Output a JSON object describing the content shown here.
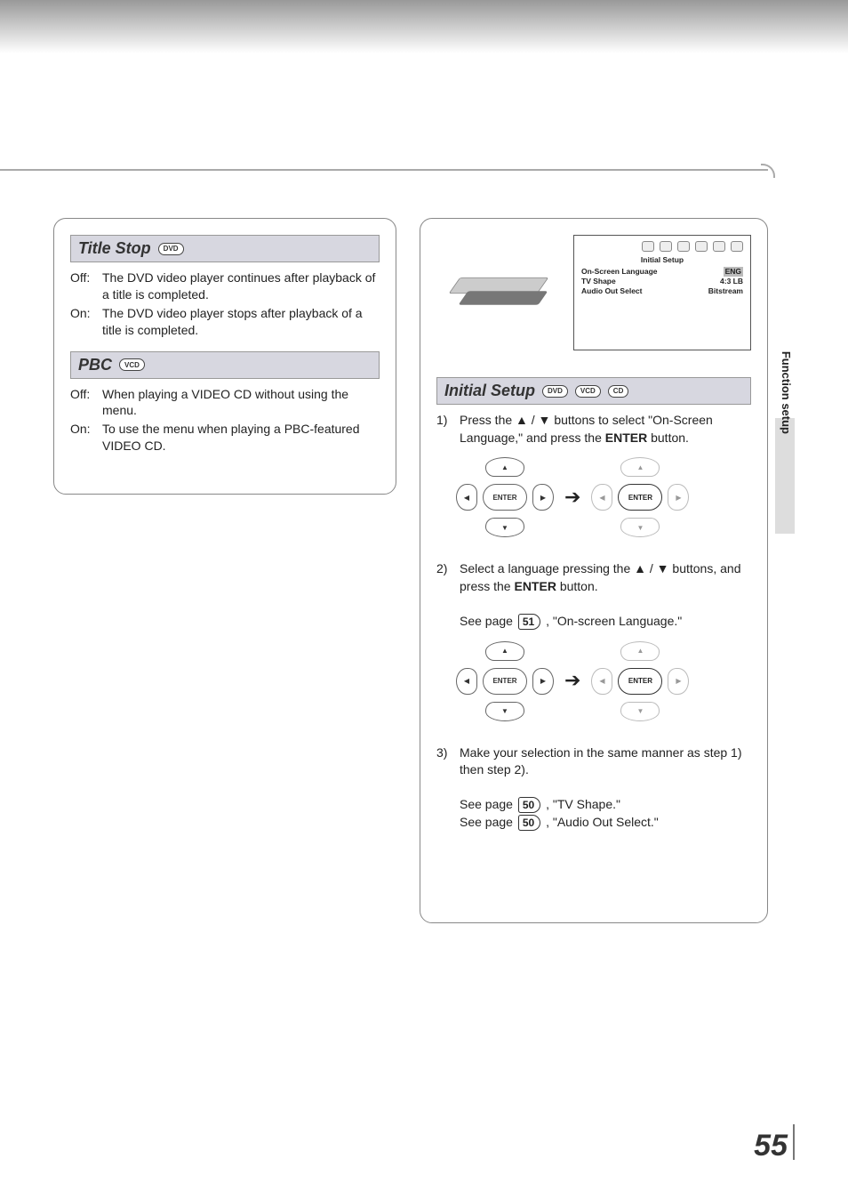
{
  "page_number": "55",
  "side_tab_label": "Function setup",
  "left": {
    "title_stop": {
      "heading": "Title Stop",
      "badges": [
        "DVD"
      ],
      "options": [
        {
          "k": "Off:",
          "v": "The DVD video player continues after playback of a title is completed."
        },
        {
          "k": "On:",
          "v": "The DVD video player stops after playback of a title is completed."
        }
      ]
    },
    "pbc": {
      "heading": "PBC",
      "badges": [
        "VCD"
      ],
      "options": [
        {
          "k": "Off:",
          "v": "When playing a VIDEO CD without using the menu."
        },
        {
          "k": "On:",
          "v": "To use the menu when playing a PBC-featured VIDEO CD."
        }
      ]
    }
  },
  "right": {
    "mini_screen": {
      "heading": "Initial Setup",
      "rows": [
        {
          "l": "On-Screen Language",
          "r": "ENG",
          "hilite": true
        },
        {
          "l": "TV Shape",
          "r": "4:3 LB"
        },
        {
          "l": "Audio Out Select",
          "r": "Bitstream"
        }
      ]
    },
    "section": {
      "heading": "Initial Setup",
      "badges": [
        "DVD",
        "VCD",
        "CD"
      ]
    },
    "steps": {
      "s1": {
        "n": "1)",
        "pre": "Press the ",
        "mid": " buttons to select \"On-Screen Language,\" and press the ",
        "bold": "ENTER",
        "post": " button."
      },
      "s2": {
        "n": "2)",
        "pre": "Select a language pressing the ",
        "mid": " buttons, and press the ",
        "bold": "ENTER",
        "post": " button.",
        "see_pre": "See page ",
        "see_ref": "51",
        "see_post": ", \"On-screen Language.\""
      },
      "s3": {
        "n": "3)",
        "text": "Make your selection in the same manner as step 1) then step 2).",
        "seeA_pre": "See page ",
        "seeA_ref": "50",
        "seeA_post": ", \"TV Shape.\"",
        "seeB_pre": "See page ",
        "seeB_ref": "50",
        "seeB_post": ", \"Audio Out Select.\""
      }
    },
    "dpad_labels": {
      "up": "▲",
      "down": "▼",
      "left": "◀",
      "right": "▶",
      "enter": "ENTER",
      "arrow": "➔",
      "updown": "▲ / ▼"
    }
  }
}
